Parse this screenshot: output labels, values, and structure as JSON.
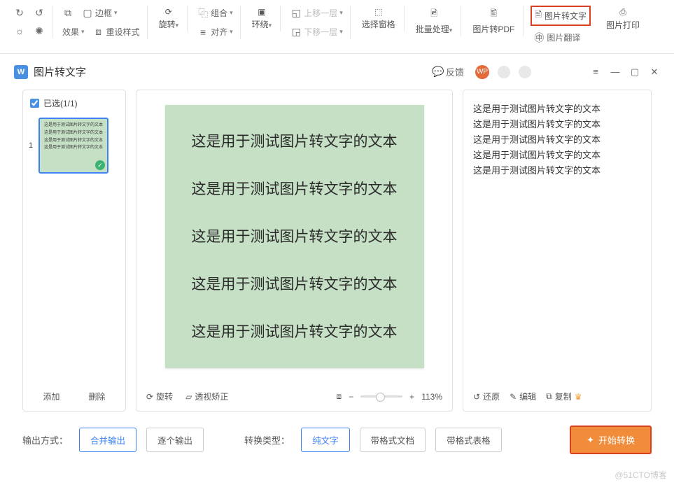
{
  "ribbon": {
    "border": "边框",
    "effects": "效果",
    "reset_style": "重设样式",
    "rotate": "旋转",
    "group": "组合",
    "align": "对齐",
    "wrap": "环绕",
    "move_up": "上移一层",
    "move_down": "下移一层",
    "select_pane": "选择窗格",
    "batch": "批量处理",
    "img_to_pdf": "图片转PDF",
    "img_to_text": "图片转文字",
    "img_translate": "图片翻译",
    "img_print": "图片打印"
  },
  "title": "图片转文字",
  "header": {
    "feedback": "反馈",
    "avatar_text": "WP"
  },
  "left": {
    "selected": "已选(1/1)",
    "thumb_idx": "1",
    "thumb_lines": [
      "这是用于测试图片转文字的文本",
      "这是用于测试图片转文字的文本",
      "这是用于测试图片转文字的文本",
      "这是用于测试图片转文字的文本"
    ],
    "add": "添加",
    "delete": "删除"
  },
  "center": {
    "preview_lines": [
      "这是用于测试图片转文字的文本",
      "这是用于测试图片转文字的文本",
      "这是用于测试图片转文字的文本",
      "这是用于测试图片转文字的文本",
      "这是用于测试图片转文字的文本"
    ],
    "rotate": "旋转",
    "perspective": "透视矫正",
    "zoom": "113%"
  },
  "right": {
    "lines": [
      "这是用于测试图片转文字的文本",
      "这是用于测试图片转文字的文本",
      "这是用于测试图片转文字的文本",
      "这是用于测试图片转文字的文本",
      "这是用于测试图片转文字的文本"
    ],
    "restore": "还原",
    "edit": "编辑",
    "copy": "复制"
  },
  "bottom": {
    "output_mode": "输出方式：",
    "merge": "合并输出",
    "each": "逐个输出",
    "convert_type": "转换类型：",
    "plain": "纯文字",
    "doc": "带格式文档",
    "table": "带格式表格",
    "start": "开始转换"
  },
  "watermark": "@51CTO博客"
}
